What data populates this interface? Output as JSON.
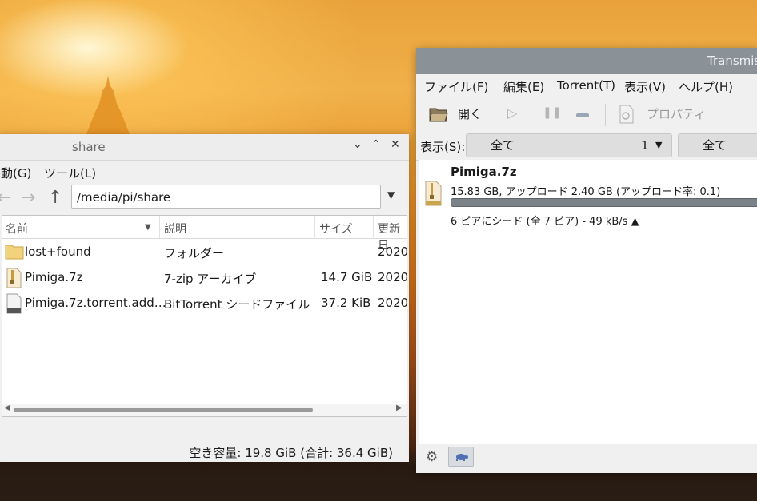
{
  "file_manager": {
    "title": "share",
    "menu": {
      "go": "移動(G)",
      "tools": "ツール(L)"
    },
    "path": "/media/pi/share",
    "columns": {
      "name": "名前",
      "description": "説明",
      "size": "サイズ",
      "modified": "更新日"
    },
    "files": [
      {
        "name": "lost+found",
        "description": "フォルダー",
        "size": "",
        "modified": "2020",
        "icon": "folder-icon"
      },
      {
        "name": "Pimiga.7z",
        "description": "7-zip アーカイブ",
        "size": "14.7 GiB",
        "modified": "2020",
        "icon": "archive-icon"
      },
      {
        "name": "Pimiga.7z.torrent.add…",
        "description": "BitTorrent シードファイル",
        "size": "37.2 KiB",
        "modified": "2020",
        "icon": "file-icon"
      }
    ],
    "status": "空き容量: 19.8 GiB (合計: 36.4 GiB)"
  },
  "transmission": {
    "title": "Transmission",
    "menu": {
      "file": "ファイル(F)",
      "edit": "編集(E)",
      "torrent": "Torrent(T)",
      "view": "表示(V)",
      "help": "ヘルプ(H)"
    },
    "toolbar": {
      "open": "開く",
      "properties": "プロパティ"
    },
    "filter": {
      "label": "表示(S):",
      "status": "全て",
      "status_count": "1",
      "tracker": "全て"
    },
    "torrents": [
      {
        "name": "Pimiga.7z",
        "info": "15.83 GB, アップロード 2.40 GB (アップロード率: 0.1)",
        "progress": 1.0,
        "status": "6 ピアにシード (全 7 ピア) - 49 kB/s ▲"
      }
    ]
  },
  "colors": {
    "transmission_titlebar": "#8a9297",
    "progress_bar": "#7b8288",
    "folder": "#f2d27a",
    "accent": "#4f6fb2"
  }
}
